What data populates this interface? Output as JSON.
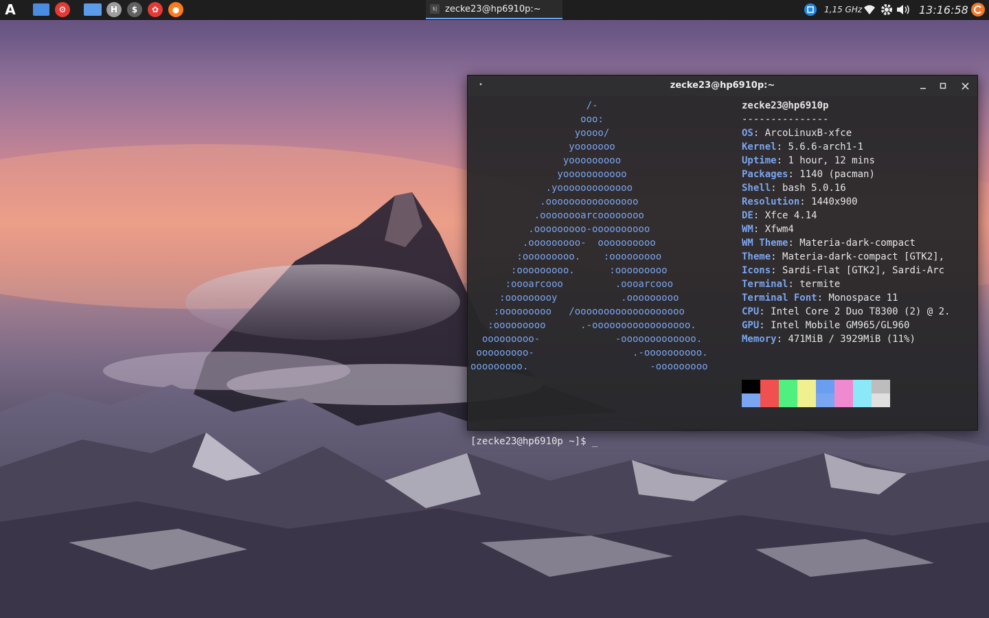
{
  "panel": {
    "launchers": [
      {
        "name": "arcolinux-logo-icon",
        "glyph": "A",
        "color": "#ffffff"
      },
      {
        "name": "desktop-icon",
        "glyph": "",
        "color": "#4a8de0"
      },
      {
        "name": "settings-icon",
        "glyph": "⚙",
        "color": "#e53935"
      },
      {
        "name": "file-manager-icon",
        "glyph": "",
        "color": "#5b9be8"
      },
      {
        "name": "hardinfo-icon",
        "glyph": "H",
        "color": "#9e9e9e"
      },
      {
        "name": "terminal-launcher-icon",
        "glyph": "$",
        "color": "#616161"
      },
      {
        "name": "app-icon",
        "glyph": "✿",
        "color": "#e53935"
      },
      {
        "name": "firefox-icon",
        "glyph": "●",
        "color": "#ff7a1a"
      }
    ],
    "task_title": "zecke23@hp6910p:~",
    "task_icon_text": "$|",
    "cpu_freq": "1,15 GHz",
    "clock": "13:16:58"
  },
  "window": {
    "title": "zecke23@hp6910p:~"
  },
  "neofetch": {
    "logo_lines": [
      "                    /-",
      "                   ooo:",
      "                  yoooo/",
      "                 yooooooo",
      "                yooooooooo",
      "               yooooooooooo",
      "             .yooooooooooooo",
      "            .oooooooooooooooo",
      "           .oooooooarcoooooooo",
      "          .ooooooooo-oooooooooo",
      "         .ooooooooo-  oooooooooo",
      "        :ooooooooo.    :ooooooooo",
      "       :ooooooooo.      :ooooooooo",
      "      :oooarcooo         .oooarcooo",
      "     :ooooooooy           .ooooooooo",
      "    :ooooooooo   /ooooooooooooooooooo",
      "   :ooooooooo      .-ooooooooooooooooo.",
      "  ooooooooo-             -ooooooooooooo.",
      " ooooooooo-                 .-oooooooooo.",
      "ooooooooo.                     -ooooooooo"
    ],
    "user_host": "zecke23@hp6910p",
    "separator": "---------------",
    "fields": [
      {
        "key": "OS",
        "value": "ArcoLinuxB-xfce"
      },
      {
        "key": "Kernel",
        "value": "5.6.6-arch1-1"
      },
      {
        "key": "Uptime",
        "value": "1 hour, 12 mins"
      },
      {
        "key": "Packages",
        "value": "1140 (pacman)"
      },
      {
        "key": "Shell",
        "value": "bash 5.0.16"
      },
      {
        "key": "Resolution",
        "value": "1440x900"
      },
      {
        "key": "DE",
        "value": "Xfce 4.14"
      },
      {
        "key": "WM",
        "value": "Xfwm4"
      },
      {
        "key": "WM Theme",
        "value": "Materia-dark-compact"
      },
      {
        "key": "Theme",
        "value": "Materia-dark-compact [GTK2],"
      },
      {
        "key": "Icons",
        "value": "Sardi-Flat [GTK2], Sardi-Arc"
      },
      {
        "key": "Terminal",
        "value": "termite"
      },
      {
        "key": "Terminal Font",
        "value": "Monospace 11"
      },
      {
        "key": "CPU",
        "value": "Intel Core 2 Duo T8300 (2) @ 2."
      },
      {
        "key": "GPU",
        "value": "Intel Mobile GM965/GL960"
      },
      {
        "key": "Memory",
        "value": "471MiB / 3929MiB (11%)"
      }
    ],
    "palette": [
      "#000000",
      "#f05050",
      "#50f080",
      "#f0f090",
      "#6a9ef0",
      "#f08ad0",
      "#8ae8f8",
      "#bdbdbd",
      "#7aa5f0",
      "#f05050",
      "#50f080",
      "#f0f090",
      "#7aa5f0",
      "#f08ad0",
      "#8ae8f8",
      "#e0e0e0"
    ]
  },
  "terminal": {
    "prompt": "[zecke23@hp6910p ~]$ _"
  }
}
